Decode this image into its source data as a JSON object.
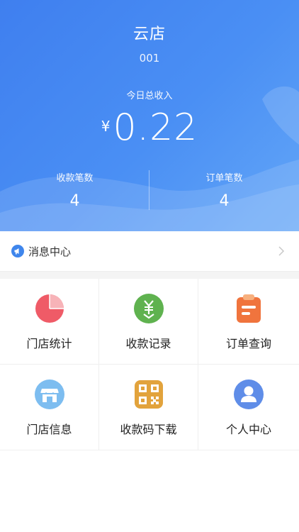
{
  "header": {
    "store_name": "云店",
    "store_id": "001",
    "income_label": "今日总收入",
    "currency": "¥",
    "income_value": "0.22",
    "stats": [
      {
        "label": "收款笔数",
        "value": "4"
      },
      {
        "label": "订单笔数",
        "value": "4"
      }
    ]
  },
  "message_center": {
    "label": "消息中心",
    "icon": "megaphone-icon"
  },
  "menu": [
    {
      "label": "门店统计",
      "icon": "pie-chart-icon",
      "color": "#ef5b67"
    },
    {
      "label": "收款记录",
      "icon": "yuan-download-icon",
      "color": "#5fb24f"
    },
    {
      "label": "订单查询",
      "icon": "clipboard-icon",
      "color": "#f0743d"
    },
    {
      "label": "门店信息",
      "icon": "storefront-icon",
      "color": "#7dbdf0"
    },
    {
      "label": "收款码下载",
      "icon": "qr-code-icon",
      "color": "#e2a33c"
    },
    {
      "label": "个人中心",
      "icon": "user-icon",
      "color": "#5f8de8"
    }
  ],
  "colors": {
    "header_gradient_start": "#3f7fef",
    "header_gradient_end": "#63a6f7"
  }
}
